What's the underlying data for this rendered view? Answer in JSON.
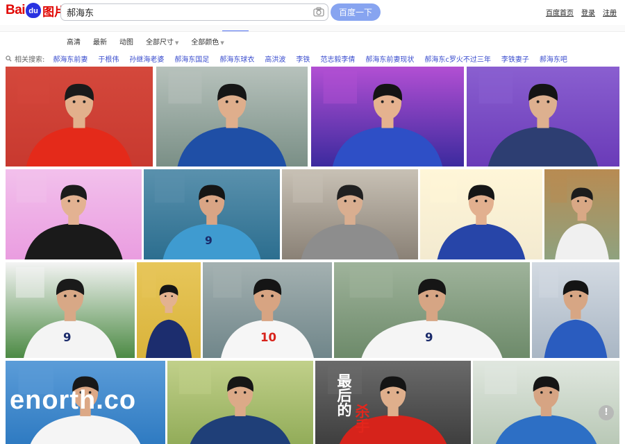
{
  "header": {
    "logo": {
      "text_left": "Bai",
      "text_paw": "du",
      "text_right": "图片"
    },
    "search": {
      "value": "郝海东",
      "button": "百度一下"
    },
    "links": [
      "百度首页",
      "登录",
      "注册"
    ]
  },
  "filters": [
    "高清",
    "最新",
    "动图",
    "全部尺寸",
    "全部颜色"
  ],
  "related": {
    "label": "相关搜索:",
    "terms": [
      "郝海东前妻",
      "于根伟",
      "孙继海老婆",
      "郝海东国足",
      "郝海东球衣",
      "高洪波",
      "李铁",
      "范志毅李倩",
      "郝海东前妻现状",
      "郝海东c罗火不过三年",
      "李铁妻子",
      "郝海东吧"
    ]
  },
  "images": [
    {
      "name": "image-1",
      "jersey": "",
      "colors": {
        "bg": "#c8392f",
        "top": "#d4483c",
        "shirt": "#e42a1a",
        "skin": "#e2b08c",
        "hair": "#1a1a1a"
      }
    },
    {
      "name": "image-2",
      "jersey": "",
      "colors": {
        "bg": "#7a8f86",
        "top": "#b7c2bc",
        "shirt": "#1f4fa6",
        "skin": "#dfae8c",
        "hair": "#161616"
      }
    },
    {
      "name": "image-3",
      "jersey": "",
      "colors": {
        "bg": "#3c2a9e",
        "top": "#b24fd3",
        "shirt": "#2e4fc6",
        "skin": "#e5b28f",
        "hair": "#141414"
      }
    },
    {
      "name": "image-4",
      "jersey": "",
      "colors": {
        "bg": "#6a3bb8",
        "top": "#8a5fd0",
        "shirt": "#2d3e72",
        "skin": "#ddb08f",
        "hair": "#141414"
      }
    },
    {
      "name": "image-5",
      "jersey": "",
      "colors": {
        "bg": "#ea9de0",
        "top": "#f2c0ec",
        "shirt": "#1a1a1a",
        "skin": "#e3b292",
        "hair": "#1b1b1b"
      }
    },
    {
      "name": "image-6",
      "jersey": "9",
      "colors": {
        "bg": "#2c6e8f",
        "top": "#5a91ad",
        "shirt": "#3f9bd0",
        "skin": "#d9a585",
        "hair": "#151515"
      }
    },
    {
      "name": "image-7",
      "jersey": "",
      "colors": {
        "bg": "#8a8176",
        "top": "#c8c1b5",
        "shirt": "#8d8d8d",
        "skin": "#d9ae90",
        "hair": "#202020"
      }
    },
    {
      "name": "image-8",
      "jersey": "",
      "colors": {
        "bg": "#f3ead0",
        "top": "#fff6d8",
        "shirt": "#2745a8",
        "skin": "#e2b08f",
        "hair": "#161616"
      }
    },
    {
      "name": "image-9",
      "jersey": "",
      "colors": {
        "bg": "#8fa27f",
        "top": "#b88b52",
        "shirt": "#f0f0f0",
        "skin": "#d9a885",
        "hair": "#1c1c1c"
      }
    },
    {
      "name": "image-10",
      "jersey": "9",
      "colors": {
        "bg": "#4c8a44",
        "top": "#f4f4f4",
        "shirt": "#f4f4f4",
        "skin": "#d8a886",
        "hair": "#1a1a1a"
      }
    },
    {
      "name": "image-11",
      "jersey": "",
      "colors": {
        "bg": "#d9b33a",
        "top": "#e7c65a",
        "shirt": "#1c2d6e",
        "skin": "#e3b290",
        "hair": "#151515"
      }
    },
    {
      "name": "image-12",
      "jersey": "10",
      "colors": {
        "bg": "#70868a",
        "top": "#a4b1b1",
        "shirt": "#f6f6f6",
        "skin": "#d7a482",
        "hair": "#151515"
      }
    },
    {
      "name": "image-13",
      "jersey": "9",
      "colors": {
        "bg": "#6d8a6a",
        "top": "#9fb39b",
        "shirt": "#f5f5f5",
        "skin": "#d6a584",
        "hair": "#161616"
      }
    },
    {
      "name": "image-14",
      "jersey": "",
      "colors": {
        "bg": "#a9b6c4",
        "top": "#d3dae2",
        "shirt": "#2a5cbf",
        "skin": "#d7a684",
        "hair": "#141414"
      }
    },
    {
      "name": "image-15",
      "jersey": "",
      "colors": {
        "bg": "#2b78c0",
        "top": "#5b9cd8",
        "shirt": "#f5f5f5",
        "skin": "#dca886",
        "hair": "#181818"
      }
    },
    {
      "name": "image-16",
      "jersey": "",
      "colors": {
        "bg": "#8ea955",
        "top": "#c1d08a",
        "shirt": "#1f3f78",
        "skin": "#dcaa88",
        "hair": "#161616"
      }
    },
    {
      "name": "image-17",
      "jersey": "",
      "colors": {
        "bg": "#3b3b3b",
        "top": "#6a6a6a",
        "shirt": "#d6231b",
        "skin": "#dfaf8c",
        "hair": "#141414"
      }
    },
    {
      "name": "image-18",
      "jersey": "",
      "colors": {
        "bg": "#b6c6b3",
        "top": "#e0e7df",
        "shirt": "#2d6fc5",
        "skin": "#d6a483",
        "hair": "#151515"
      }
    }
  ],
  "overlays": {
    "enorth": "enorth.co",
    "slogan_black": "最后的",
    "slogan_red": "杀手",
    "badge": "!"
  },
  "accent": {
    "brand_red": "#e10602",
    "brand_blue": "#2932e1",
    "link_blue": "#3a4dce",
    "button_blue": "#87a4f0"
  }
}
